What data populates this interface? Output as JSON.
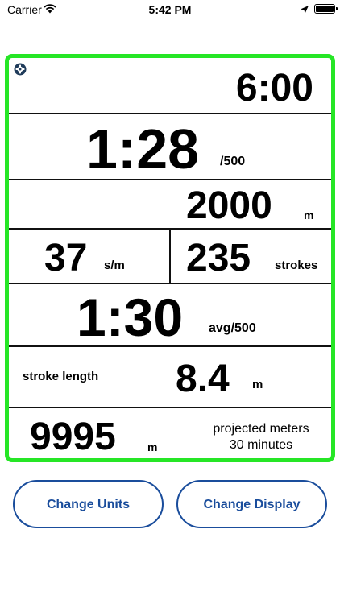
{
  "status_bar": {
    "carrier": "Carrier",
    "time": "5:42 PM",
    "wifi_icon": "wifi-icon",
    "location_icon": "location-arrow-icon",
    "battery_icon": "battery-icon"
  },
  "colors": {
    "frame": "#26e626",
    "button": "#1a4d9c"
  },
  "monitor": {
    "settings_icon": "gear-icon",
    "elapsed_time": "6:00",
    "split": {
      "value": "1:28",
      "unit": "/500"
    },
    "distance": {
      "value": "2000",
      "unit": "m"
    },
    "stroke_rate": {
      "value": "37",
      "unit": "s/m"
    },
    "strokes": {
      "value": "235",
      "unit": "strokes"
    },
    "avg_split": {
      "value": "1:30",
      "unit": "avg/500"
    },
    "stroke_length": {
      "label": "stroke length",
      "value": "8.4",
      "unit": "m"
    },
    "projection": {
      "value": "9995",
      "unit": "m",
      "label_line1": "projected meters",
      "label_line2": "30 minutes"
    }
  },
  "buttons": {
    "change_units": "Change Units",
    "change_display": "Change Display"
  }
}
